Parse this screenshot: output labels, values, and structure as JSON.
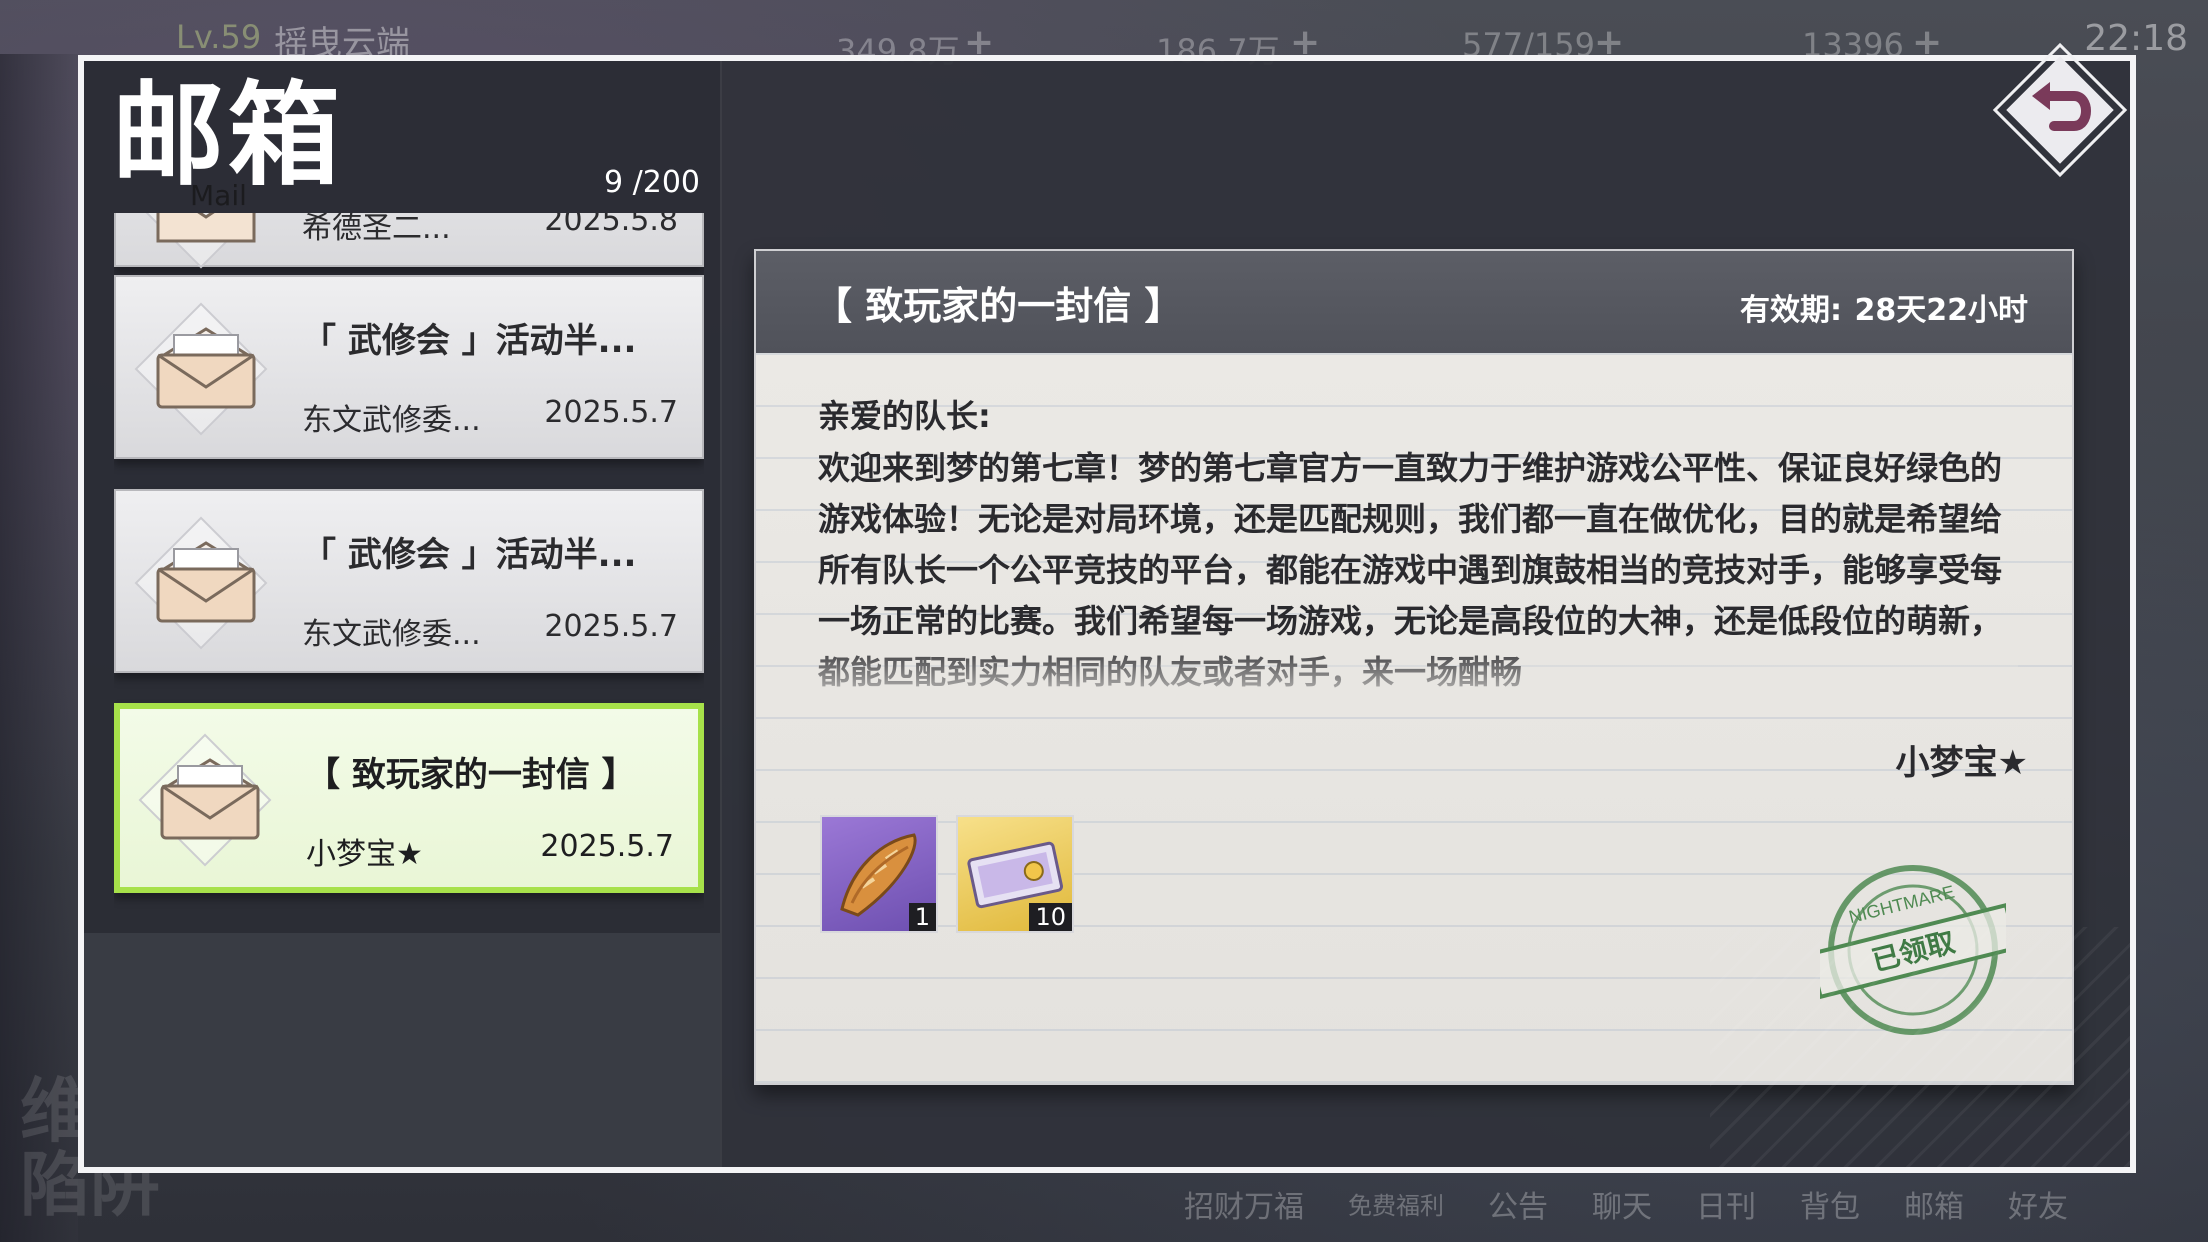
{
  "hud": {
    "level": "Lv.59",
    "player_name": "摇曳云端",
    "currencies": [
      {
        "value": "349.8万",
        "icon": "gold-coin-icon"
      },
      {
        "value": "186.7万",
        "icon": "crystal-icon"
      },
      {
        "value": "577/159",
        "icon": "stamina-icon"
      },
      {
        "value": "13396",
        "icon": "gem-icon"
      }
    ],
    "time": "22:18"
  },
  "bottom_nav": [
    "招财万福",
    "免费福利",
    "公告",
    "聊天",
    "日刊",
    "背包",
    "邮箱",
    "好友"
  ],
  "mailbox": {
    "title": "邮箱",
    "subtitle": "Mail",
    "count": "9 /200",
    "items": [
      {
        "subject": "",
        "sender": "希德圣二...",
        "date": "2025.5.8"
      },
      {
        "subject": "「 武修会 」活动半...",
        "sender": "东文武修委...",
        "date": "2025.5.7"
      },
      {
        "subject": "「 武修会 」活动半...",
        "sender": "东文武修委...",
        "date": "2025.5.7"
      },
      {
        "subject": "【 致玩家的一封信 】",
        "sender": "小梦宝★",
        "date": "2025.5.7",
        "selected": true
      }
    ]
  },
  "letter": {
    "title": "【 致玩家的一封信 】",
    "expiry_label": "有效期:",
    "expiry_value": "28天22小时",
    "greeting": "亲爱的队长:",
    "body": "欢迎来到梦的第七章！梦的第七章官方一直致力于维护游戏公平性、保证良好绿色的游戏体验！无论是对局环境，还是匹配规则，我们都一直在做优化，目的就是希望给所有队长一个公平竞技的平台，都能在游戏中遇到旗鼓相当的竞技对手，能够享受每一场正常的比赛。我们希望每一场游戏，无论是高段位的大神，还是低段位的萌新，都能匹配到实力相同的队友或者对手，来一场酣畅",
    "signature": "小梦宝★",
    "rewards": [
      {
        "icon": "bread-icon",
        "qty": "1",
        "rarity_color": "#7e5cc4"
      },
      {
        "icon": "ticket-icon",
        "qty": "10",
        "rarity_color": "#e8c650"
      }
    ],
    "stamp": {
      "top_text": "NIGHTMARE",
      "label": "已领取"
    }
  },
  "colors": {
    "selected_border": "#a7e14a",
    "stamp_green": "#4f8a52"
  }
}
